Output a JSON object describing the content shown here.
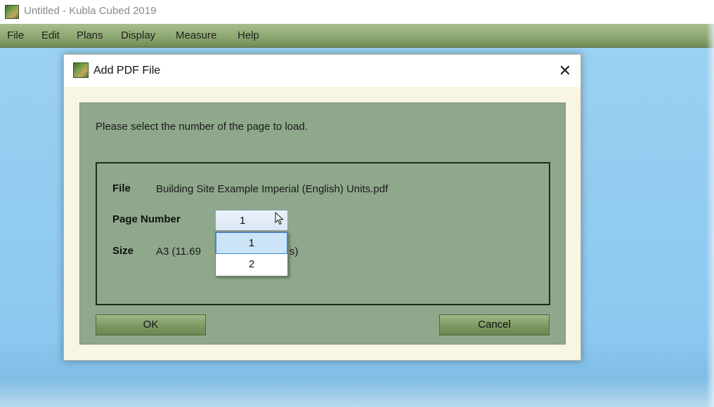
{
  "window": {
    "title": "Untitled - Kubla Cubed 2019",
    "icon": "kubla-cubed-app-icon"
  },
  "menu": {
    "file": "File",
    "edit": "Edit",
    "plans": "Plans",
    "display": "Display",
    "measure": "Measure",
    "help": "Help"
  },
  "dialog": {
    "title": "Add PDF File",
    "close_glyph": "✕",
    "prompt": "Please select the number of the page to load.",
    "file_label": "File",
    "file_value": "Building Site Example Imperial (English) Units.pdf",
    "page_label": "Page Number",
    "page_value": "1",
    "page_options": [
      "1",
      "2"
    ],
    "size_label": "Size",
    "size_value_visible_left": "A3 (11.69 ",
    "size_value_visible_right": "s)",
    "ok_label": "OK",
    "cancel_label": "Cancel"
  },
  "colors": {
    "desktop": "#9bcdf0",
    "menubar": "#8ea872",
    "dialog_frame": "#f8f5e2",
    "dialog_body": "#8fa88b",
    "selection": "#cce4f7"
  }
}
